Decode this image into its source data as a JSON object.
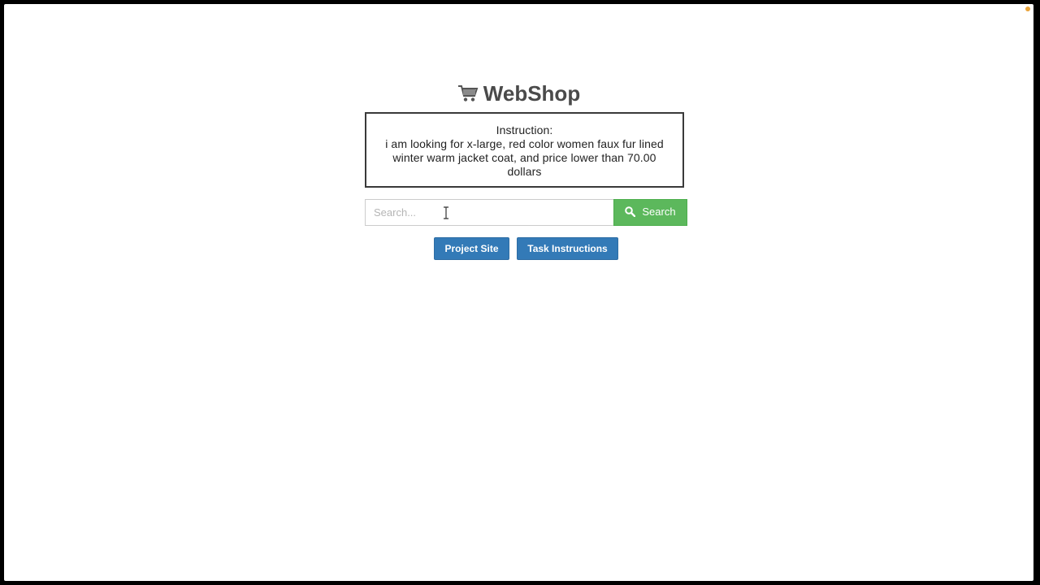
{
  "brand": {
    "icon": "shopping-cart-icon",
    "name": "WebShop"
  },
  "instruction": {
    "label": "Instruction:",
    "text": "i am looking for x-large, red color women faux fur lined winter warm jacket coat, and price lower than 70.00 dollars"
  },
  "search": {
    "placeholder": "Search...",
    "value": "",
    "button_label": "Search",
    "button_icon": "search-icon"
  },
  "links": {
    "project_site": "Project Site",
    "task_instructions": "Task Instructions"
  },
  "colors": {
    "search_button": "#5cb85c",
    "link_buttons": "#337ab7",
    "notification_dot": "#e8a33a"
  }
}
